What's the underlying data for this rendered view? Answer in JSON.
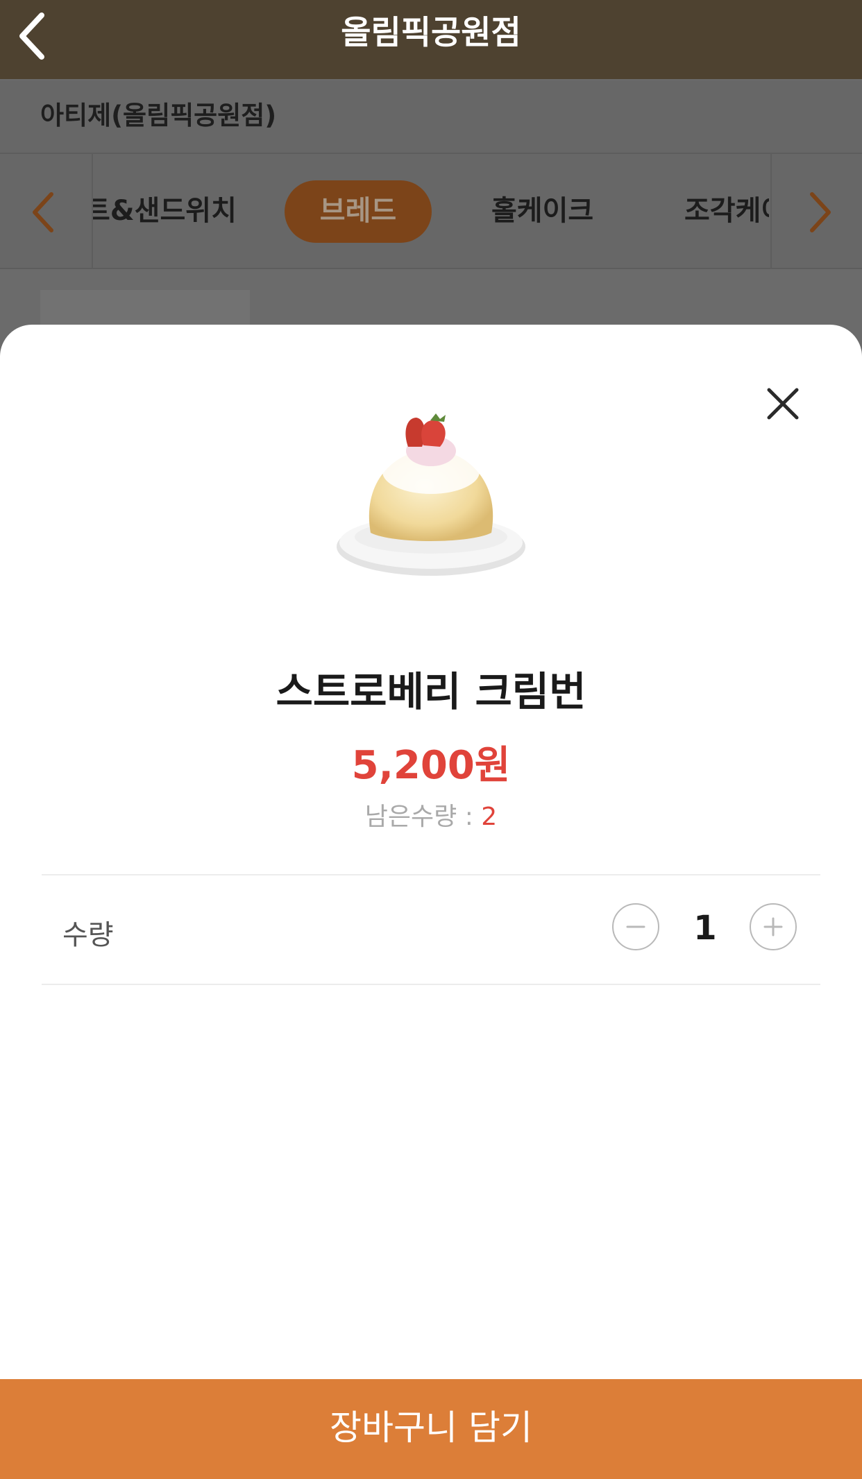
{
  "header": {
    "title": "올림픽공원점"
  },
  "store": {
    "name": "아티제(올림픽공원점)"
  },
  "categories": [
    {
      "label": "트&샌드위치",
      "active": false
    },
    {
      "label": "브레드",
      "active": true
    },
    {
      "label": "홀케이크",
      "active": false
    },
    {
      "label": "조각케이크",
      "active": false
    }
  ],
  "product": {
    "name": "스트로베리 크림번",
    "price": "5,200원",
    "stock_label": "남은수량 :",
    "stock_value": "2"
  },
  "quantity": {
    "label": "수량",
    "value": "1"
  },
  "cart_button": {
    "label": "장바구니 담기"
  },
  "colors": {
    "header_bg": "#4e4230",
    "accent": "#dc7e38",
    "price": "#e0433a",
    "active_category_bg": "#7c4419"
  },
  "icons": {
    "back": "chevron-left-icon",
    "category_prev": "chevron-left-icon",
    "category_next": "chevron-right-icon",
    "close": "close-icon",
    "minus": "minus-icon",
    "plus": "plus-icon"
  }
}
